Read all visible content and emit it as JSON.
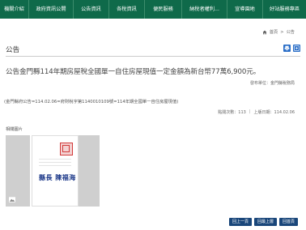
{
  "nav": {
    "items": [
      "機關介紹",
      "政府資訊公開",
      "公告資訊",
      "各稅資訊",
      "便民服務",
      "納稅者權利...",
      "宣導園地",
      "好站服務專區"
    ]
  },
  "breadcrumb": {
    "home": "首頁",
    "separator": ">",
    "current": "公告"
  },
  "page": {
    "title": "公告"
  },
  "announcement": {
    "headline": "公告金門縣114年期房屋稅全國單一自住房屋現值一定金額為新台幣77萬6,900元。",
    "publisher_label": "發布單位：",
    "publisher": "金門縣稅務局",
    "reference": "(金門縣府公告=114.02.06=府財稅字第1140010109號=114年期全國單一自住房屋現值)",
    "views_label": "點閱次數：",
    "views": "113",
    "date_label": "上版日期：",
    "date": "114.02.06",
    "images_label": "相關圖片",
    "signature": "縣長 陳福海"
  },
  "buttons": {
    "prev": "回上一頁",
    "print_top": "回最上層",
    "back_home": "回首頁"
  },
  "colors": {
    "nav": "#0f6a4a",
    "tool": "#2a6ec7",
    "button": "#19467a",
    "seal": "#d23b3b"
  }
}
